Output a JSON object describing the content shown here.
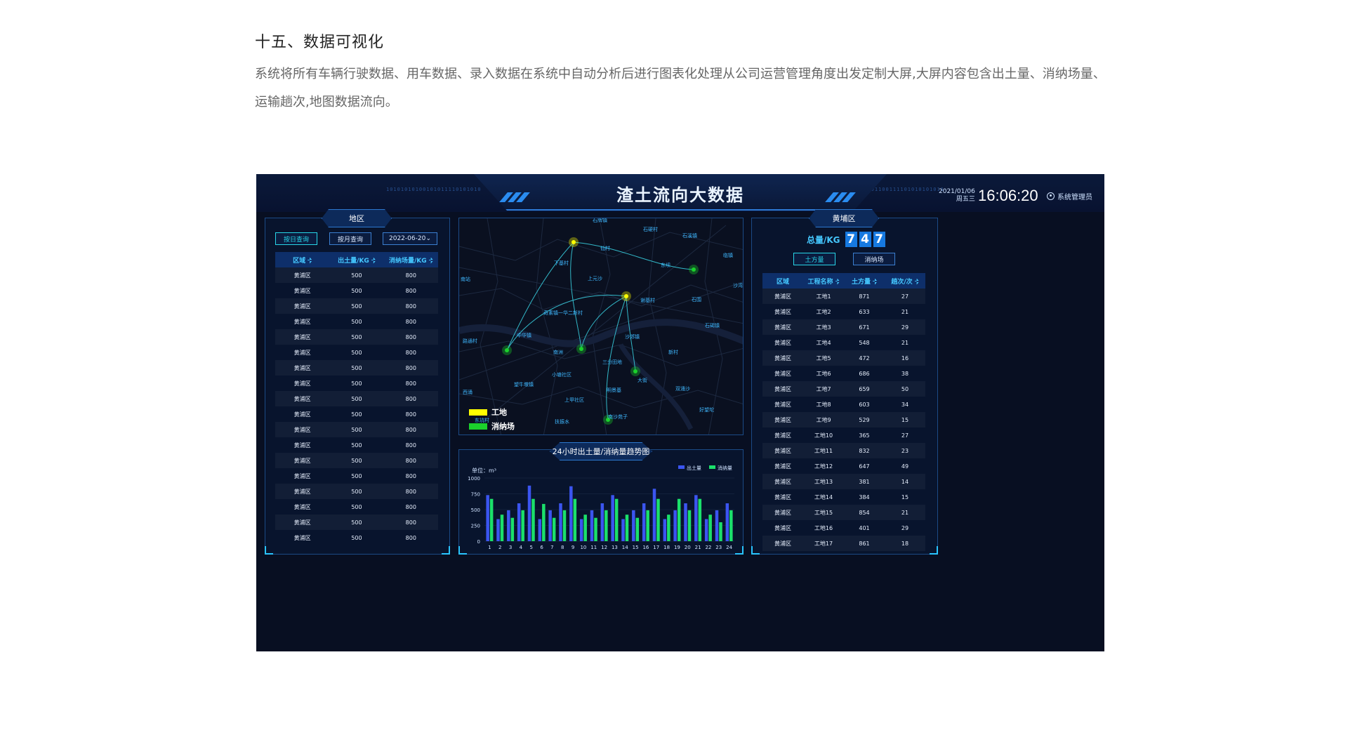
{
  "page": {
    "heading": "十五、数据可视化",
    "description": "系统将所有车辆行驶数据、用车数据、录入数据在系统中自动分析后进行图表化处理从公司运营管理角度出发定制大屏,大屏内容包含出土量、消纳场量、运输趟次,地图数据流向。"
  },
  "dashboard": {
    "title": "渣土流向大数据",
    "date": "2021/01/06",
    "weekday": "周五三",
    "time": "16:06:20",
    "user": "系统管理员",
    "binary_left": "10101010100101011110101010",
    "binary_right": "10101100111101010101011"
  },
  "left_panel": {
    "tag": "地区",
    "btn_day": "按日查询",
    "btn_month": "按月查询",
    "date_value": "2022-06-20",
    "columns": [
      "区域",
      "出土量/KG",
      "消纳场量/KG"
    ],
    "rows": [
      [
        "黄浦区",
        "500",
        "800"
      ],
      [
        "黄浦区",
        "500",
        "800"
      ],
      [
        "黄浦区",
        "500",
        "800"
      ],
      [
        "黄浦区",
        "500",
        "800"
      ],
      [
        "黄浦区",
        "500",
        "800"
      ],
      [
        "黄浦区",
        "500",
        "800"
      ],
      [
        "黄浦区",
        "500",
        "800"
      ],
      [
        "黄浦区",
        "500",
        "800"
      ],
      [
        "黄浦区",
        "500",
        "800"
      ],
      [
        "黄浦区",
        "500",
        "800"
      ],
      [
        "黄浦区",
        "500",
        "800"
      ],
      [
        "黄浦区",
        "500",
        "800"
      ],
      [
        "黄浦区",
        "500",
        "800"
      ],
      [
        "黄浦区",
        "500",
        "800"
      ],
      [
        "黄浦区",
        "500",
        "800"
      ],
      [
        "黄浦区",
        "500",
        "800"
      ],
      [
        "黄浦区",
        "500",
        "800"
      ],
      [
        "黄浦区",
        "500",
        "800"
      ]
    ]
  },
  "map": {
    "places": [
      "石牌镇",
      "石硬村",
      "石溪镇",
      "仙村",
      "下基村",
      "上元沙",
      "东坝",
      "临镇",
      "南站",
      "沙湾镇",
      "谢基村",
      "石围",
      "奇素镇一华二新村",
      "石碣镇",
      "中华镇",
      "路通村",
      "南洲",
      "沙郊镇",
      "新村",
      "三分田地",
      "小塘社区",
      "大街",
      "西涌",
      "望牛墩镇",
      "明景基",
      "双涌沙",
      "上甲社区",
      "南沙苑子",
      "好望坨",
      "扶振水",
      "东坑村"
    ],
    "legend": {
      "site": "工地",
      "dump": "消纳场"
    },
    "colors": {
      "site": "#ffff00",
      "dump": "#1bd12c",
      "flow": "#3ad6e6"
    }
  },
  "chart_data": {
    "type": "bar",
    "title": "24小时出土量/消纳量趋势图",
    "unit": "单位：m³",
    "ylim": [
      0,
      1000
    ],
    "yticks": [
      0,
      250,
      500,
      750,
      1000
    ],
    "categories": [
      "1",
      "2",
      "3",
      "4",
      "5",
      "6",
      "7",
      "8",
      "9",
      "10",
      "11",
      "12",
      "13",
      "14",
      "15",
      "16",
      "17",
      "18",
      "19",
      "20",
      "21",
      "22",
      "23",
      "24"
    ],
    "series": [
      {
        "name": "出土量",
        "color": "#3b55f0",
        "values": [
          730,
          350,
          490,
          600,
          880,
          350,
          490,
          600,
          870,
          350,
          490,
          600,
          730,
          350,
          490,
          600,
          830,
          350,
          490,
          600,
          730,
          350,
          490,
          600
        ]
      },
      {
        "name": "消纳量",
        "color": "#1be06b",
        "values": [
          670,
          420,
          370,
          490,
          670,
          590,
          370,
          490,
          670,
          420,
          370,
          490,
          670,
          420,
          370,
          490,
          670,
          420,
          670,
          490,
          670,
          420,
          300,
          490
        ]
      }
    ]
  },
  "right_panel": {
    "tag": "黄埔区",
    "total_label": "总量/KG",
    "total_digits": [
      "7",
      "4",
      "7"
    ],
    "btn_earth": "土方量",
    "btn_dump": "消纳场",
    "columns": [
      "区域",
      "工程名称",
      "土方量",
      "趟次/次"
    ],
    "rows": [
      [
        "黄浦区",
        "工地1",
        "871",
        "27"
      ],
      [
        "黄浦区",
        "工地2",
        "633",
        "21"
      ],
      [
        "黄浦区",
        "工地3",
        "671",
        "29"
      ],
      [
        "黄浦区",
        "工地4",
        "548",
        "21"
      ],
      [
        "黄浦区",
        "工地5",
        "472",
        "16"
      ],
      [
        "黄浦区",
        "工地6",
        "686",
        "38"
      ],
      [
        "黄浦区",
        "工地7",
        "659",
        "50"
      ],
      [
        "黄浦区",
        "工地8",
        "603",
        "34"
      ],
      [
        "黄浦区",
        "工地9",
        "529",
        "15"
      ],
      [
        "黄浦区",
        "工地10",
        "365",
        "27"
      ],
      [
        "黄浦区",
        "工地11",
        "832",
        "23"
      ],
      [
        "黄浦区",
        "工地12",
        "647",
        "49"
      ],
      [
        "黄浦区",
        "工地13",
        "381",
        "14"
      ],
      [
        "黄浦区",
        "工地14",
        "384",
        "15"
      ],
      [
        "黄浦区",
        "工地15",
        "854",
        "21"
      ],
      [
        "黄浦区",
        "工地16",
        "401",
        "29"
      ],
      [
        "黄浦区",
        "工地17",
        "861",
        "18"
      ]
    ]
  }
}
